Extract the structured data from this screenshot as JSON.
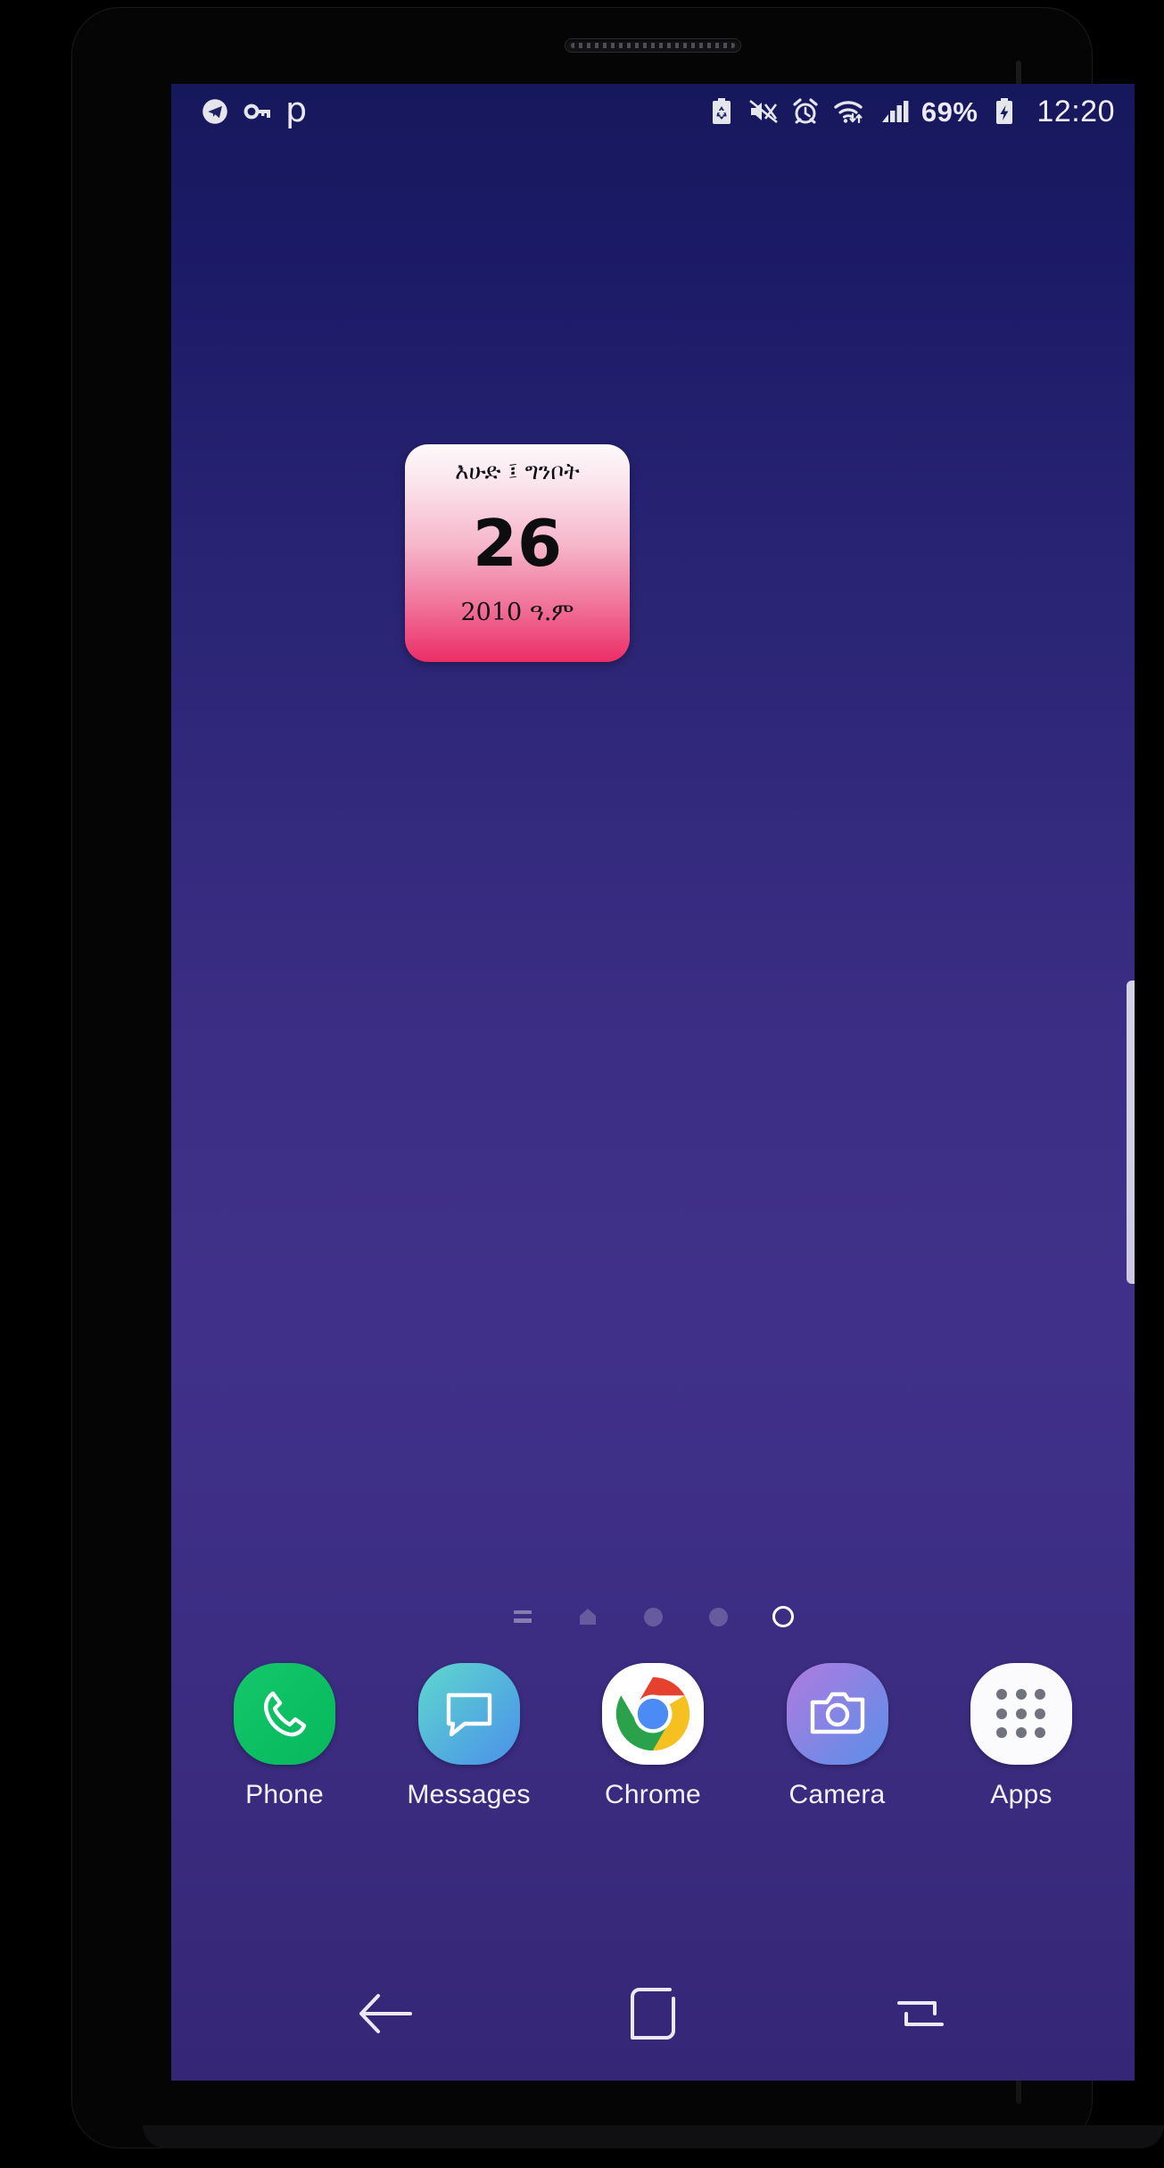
{
  "device": {
    "name": "samsung-galaxy-phone"
  },
  "status_bar": {
    "left_icons": [
      {
        "name": "telegram-icon",
        "label": "Telegram"
      },
      {
        "name": "vpn-key-icon",
        "label": "VPN"
      },
      {
        "name": "app-letter-p-icon",
        "label": "p"
      }
    ],
    "right_icons": [
      {
        "name": "power-saving-icon",
        "label": "Power saving"
      },
      {
        "name": "mute-icon",
        "label": "Sound off"
      },
      {
        "name": "alarm-icon",
        "label": "Alarm set"
      },
      {
        "name": "wifi-icon",
        "label": "Wi-Fi"
      },
      {
        "name": "signal-bars-icon",
        "label": "Mobile signal"
      }
    ],
    "battery_percent": "69%",
    "battery_icon": "battery-charging-icon",
    "time": "12:20"
  },
  "widget": {
    "name": "ethiopian-calendar-widget",
    "weekday_month": "እሁድ ፤ ግንቦት",
    "day": "26",
    "year_era": "2010  ዓ.ም",
    "colors": {
      "top": "#fdfafc",
      "bottom": "#ec2d66"
    }
  },
  "page_indicator": {
    "items": [
      {
        "name": "page-dot-briefing",
        "type": "lines",
        "active": false
      },
      {
        "name": "page-dot-home",
        "type": "home",
        "active": false
      },
      {
        "name": "page-dot-3",
        "type": "dot",
        "active": false
      },
      {
        "name": "page-dot-4",
        "type": "dot",
        "active": false
      },
      {
        "name": "page-dot-5",
        "type": "current",
        "active": true
      }
    ]
  },
  "dock": {
    "apps": [
      {
        "name": "phone",
        "label": "Phone",
        "icon": "phone-handset-icon",
        "color": "#0fbf63"
      },
      {
        "name": "messages",
        "label": "Messages",
        "icon": "speech-bubble-icon",
        "color": "#4a90ea"
      },
      {
        "name": "chrome",
        "label": "Chrome",
        "icon": "chrome-icon",
        "color": "#ffffff"
      },
      {
        "name": "camera",
        "label": "Camera",
        "icon": "camera-icon",
        "color": "#7d86e6"
      },
      {
        "name": "apps",
        "label": "Apps",
        "icon": "apps-grid-icon",
        "color": "#ffffff"
      }
    ]
  },
  "nav_bar": {
    "buttons": [
      {
        "name": "back-button",
        "icon": "arrow-left-icon",
        "label": "Back"
      },
      {
        "name": "home-button",
        "icon": "rounded-square-icon",
        "label": "Home"
      },
      {
        "name": "recents-button",
        "icon": "recents-icon",
        "label": "Recents"
      }
    ]
  },
  "edge_panel": {
    "name": "edge-panel-handle"
  },
  "wallpaper": {
    "top_color": "#16185c",
    "bottom_color": "#352676"
  }
}
